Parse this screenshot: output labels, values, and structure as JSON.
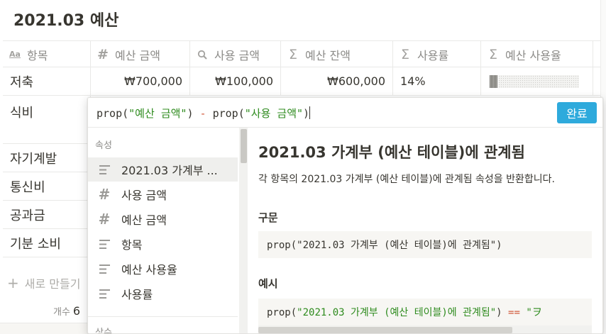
{
  "page": {
    "title": "2021.03 예산"
  },
  "table": {
    "columns": [
      {
        "icon": "text-type-icon",
        "glyph": "Aa",
        "label": "항목"
      },
      {
        "icon": "number-icon",
        "glyph": "#",
        "label": "예산 금액"
      },
      {
        "icon": "search-icon",
        "glyph": "⚲",
        "label": "사용 금액"
      },
      {
        "icon": "formula-sigma-icon",
        "glyph": "Σ",
        "label": "예산 잔액"
      },
      {
        "icon": "formula-sigma-icon",
        "glyph": "Σ",
        "label": "사용률"
      },
      {
        "icon": "formula-sigma-icon",
        "glyph": "Σ",
        "label": "예산 사용율"
      }
    ],
    "rows": [
      {
        "name": "저축",
        "budget": "₩700,000",
        "spent": "₩100,000",
        "remain": "₩600,000",
        "rate": "14%",
        "usage_fraction": 0.14
      },
      {
        "name": "식비"
      },
      {
        "name": "자기계발"
      },
      {
        "name": "통신비"
      },
      {
        "name": "공과금"
      },
      {
        "name": "기분 소비"
      }
    ],
    "new_row_label": "새로 만들기",
    "count_label": "개수",
    "count_value": "6"
  },
  "formula_popup": {
    "formula": {
      "fn1": "prop(",
      "arg1": "\"예산 금액\"",
      "close1": ")",
      "op": "-",
      "fn2": "prop(",
      "arg2": "\"사용 금액\"",
      "close2": ")"
    },
    "done_label": "완료",
    "properties_section_label": "속성",
    "properties": [
      {
        "icon": "text-lines-icon",
        "label": "2021.03 가계부 ...",
        "selected": true
      },
      {
        "icon": "number-icon",
        "label": "사용 금액"
      },
      {
        "icon": "number-icon",
        "label": "예산 금액"
      },
      {
        "icon": "text-lines-icon",
        "label": "항목"
      },
      {
        "icon": "text-lines-icon",
        "label": "예산 사용율"
      },
      {
        "icon": "text-lines-icon",
        "label": "사용률"
      }
    ],
    "constants_section_label": "상수",
    "detail": {
      "title": "2021.03 가계부 (예산 테이블)에 관계됨",
      "description": "각 항목의 2021.03 가계부 (예산 테이블)에 관계됨 속성을 반환합니다.",
      "syntax_heading": "구문",
      "syntax_fn": "prop(",
      "syntax_arg": "\"2021.03 가계부 (예산 테이블)에 관계됨\"",
      "syntax_close": ")",
      "example_heading": "예시",
      "example_fn": "prop(",
      "example_arg": "\"2021.03 가계부 (예산 테이블)에 관계됨\"",
      "example_close": ")",
      "example_op": "==",
      "example_rest": "\"ヲ"
    }
  },
  "colors": {
    "accent": "#2eaadc",
    "string": "#2e8b1e",
    "operator": "#d25a3c"
  }
}
